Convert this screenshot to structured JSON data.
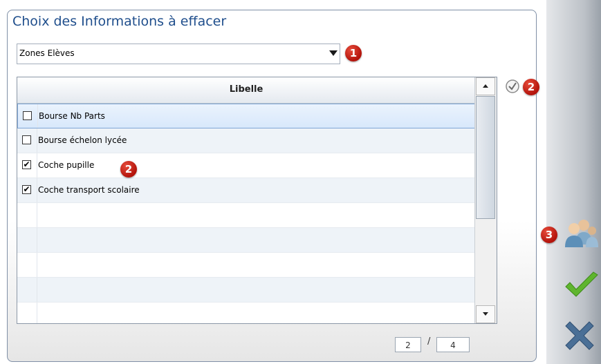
{
  "dialog": {
    "title": "Choix des Informations à effacer"
  },
  "combo": {
    "value": "Zones Elèves"
  },
  "badges": {
    "b1": "1",
    "b2a": "2",
    "b2b": "2",
    "b3": "3"
  },
  "grid": {
    "header": "Libelle",
    "rows": [
      {
        "label": "Bourse Nb Parts",
        "checked": false,
        "mark": ""
      },
      {
        "label": "Bourse échelon lycée",
        "checked": false,
        "mark": ""
      },
      {
        "label": "Coche pupille",
        "checked": true,
        "mark": "✔"
      },
      {
        "label": "Coche transport scolaire",
        "checked": true,
        "mark": "✔"
      },
      {
        "label": "",
        "checked": false,
        "mark": ""
      },
      {
        "label": "",
        "checked": false,
        "mark": ""
      },
      {
        "label": "",
        "checked": false,
        "mark": ""
      },
      {
        "label": "",
        "checked": false,
        "mark": ""
      },
      {
        "label": "",
        "checked": false,
        "mark": ""
      }
    ]
  },
  "pager": {
    "current": "2",
    "separator": "/",
    "total": "4"
  },
  "icons": {
    "toggle_all": "check-circle-icon",
    "users": "users-icon",
    "validate": "checkmark-icon",
    "cancel": "close-icon"
  },
  "colors": {
    "title": "#1f4e8c",
    "badge": "#c0180e",
    "validate": "#5fb52e",
    "cancel": "#4a6f96"
  }
}
